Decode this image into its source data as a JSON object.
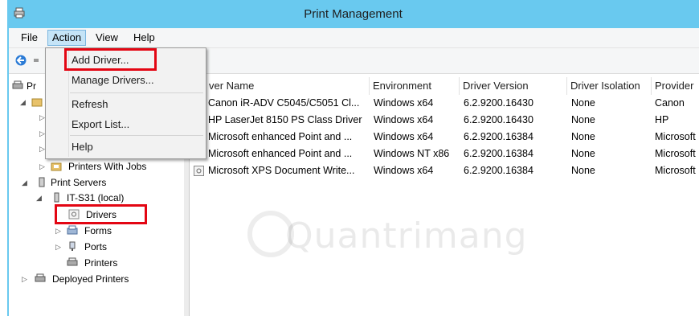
{
  "window": {
    "title": "Print Management"
  },
  "menubar": {
    "items": [
      {
        "label": "File"
      },
      {
        "label": "Action"
      },
      {
        "label": "View"
      },
      {
        "label": "Help"
      }
    ]
  },
  "context_menu": {
    "items": [
      {
        "label": "Add Driver..."
      },
      {
        "label": "Manage Drivers..."
      },
      {
        "label": "Refresh"
      },
      {
        "label": "Export List..."
      },
      {
        "label": "Help"
      }
    ]
  },
  "tree": {
    "root_label_partial": "Pr",
    "printers_with_jobs": "Printers With Jobs",
    "print_servers": "Print Servers",
    "server": "IT-S31 (local)",
    "drivers": "Drivers",
    "forms": "Forms",
    "ports": "Ports",
    "printers": "Printers",
    "deployed_printers": "Deployed Printers"
  },
  "table": {
    "columns": [
      {
        "label": "ver Name"
      },
      {
        "label": "Environment"
      },
      {
        "label": "Driver Version"
      },
      {
        "label": "Driver Isolation"
      },
      {
        "label": "Provider"
      }
    ],
    "rows": [
      {
        "name": "Canon iR-ADV C5045/C5051 Cl...",
        "env": "Windows x64",
        "version": "6.2.9200.16430",
        "isolation": "None",
        "provider": "Canon"
      },
      {
        "name": "HP LaserJet 8150 PS Class Driver",
        "env": "Windows x64",
        "version": "6.2.9200.16430",
        "isolation": "None",
        "provider": "HP"
      },
      {
        "name": "Microsoft enhanced Point and ...",
        "env": "Windows x64",
        "version": "6.2.9200.16384",
        "isolation": "None",
        "provider": "Microsoft"
      },
      {
        "name": "Microsoft enhanced Point and ...",
        "env": "Windows NT x86",
        "version": "6.2.9200.16384",
        "isolation": "None",
        "provider": "Microsoft"
      },
      {
        "name": "Microsoft XPS Document Write...",
        "env": "Windows x64",
        "version": "6.2.9200.16384",
        "isolation": "None",
        "provider": "Microsoft"
      }
    ]
  },
  "watermark": "Quantrimang",
  "colors": {
    "titlebar": "#69c9ef",
    "highlight": "#e30613",
    "menu_active": "#c5e4f7"
  }
}
